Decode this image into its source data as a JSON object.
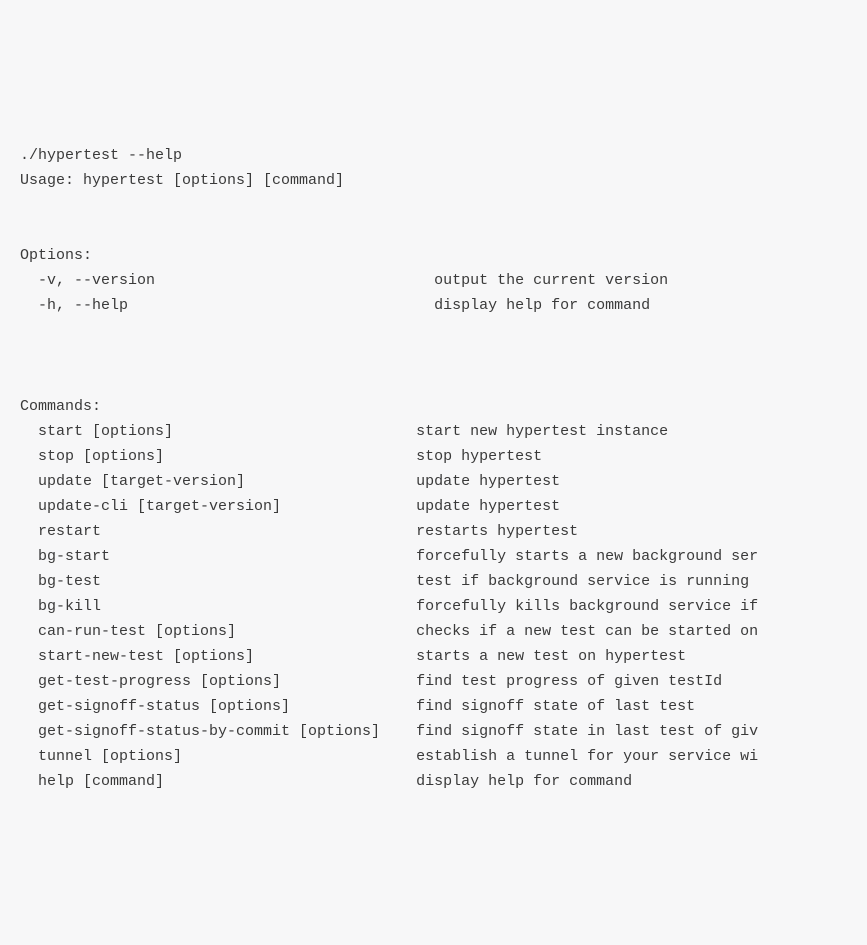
{
  "invocation": "./hypertest --help",
  "usage": "Usage: hypertest [options] [command]",
  "optionsHeader": "Options:",
  "commandsHeader": "Commands:",
  "options": [
    {
      "flag": "-v, --version",
      "desc": "output the current version",
      "pad": "                               "
    },
    {
      "flag": "-h, --help",
      "desc": "display help for command",
      "pad": "                                  "
    }
  ],
  "commands": [
    {
      "name": "start [options]",
      "desc": "start new hypertest instance",
      "pad": "                           "
    },
    {
      "name": "stop [options]",
      "desc": "stop hypertest",
      "pad": "                            "
    },
    {
      "name": "update [target-version]",
      "desc": "update hypertest",
      "pad": "                   "
    },
    {
      "name": "update-cli [target-version]",
      "desc": "update hypertest",
      "pad": "               "
    },
    {
      "name": "restart",
      "desc": "restarts hypertest",
      "pad": "                                   "
    },
    {
      "name": "bg-start",
      "desc": "forcefully starts a new background ser",
      "pad": "                                  "
    },
    {
      "name": "bg-test",
      "desc": "test if background service is running ",
      "pad": "                                   "
    },
    {
      "name": "bg-kill",
      "desc": "forcefully kills background service if",
      "pad": "                                   "
    },
    {
      "name": "can-run-test [options]",
      "desc": "checks if a new test can be started on",
      "pad": "                    "
    },
    {
      "name": "start-new-test [options]",
      "desc": "starts a new test on hypertest",
      "pad": "                  "
    },
    {
      "name": "get-test-progress [options]",
      "desc": "find test progress of given testId",
      "pad": "               "
    },
    {
      "name": "get-signoff-status [options]",
      "desc": "find signoff state of last test",
      "pad": "              "
    },
    {
      "name": "get-signoff-status-by-commit [options]",
      "desc": "find signoff state in last test of giv",
      "pad": "    "
    },
    {
      "name": "tunnel [options]",
      "desc": "establish a tunnel for your service wi",
      "pad": "                          "
    },
    {
      "name": "help [command]",
      "desc": "display help for command",
      "pad": "                            "
    }
  ]
}
